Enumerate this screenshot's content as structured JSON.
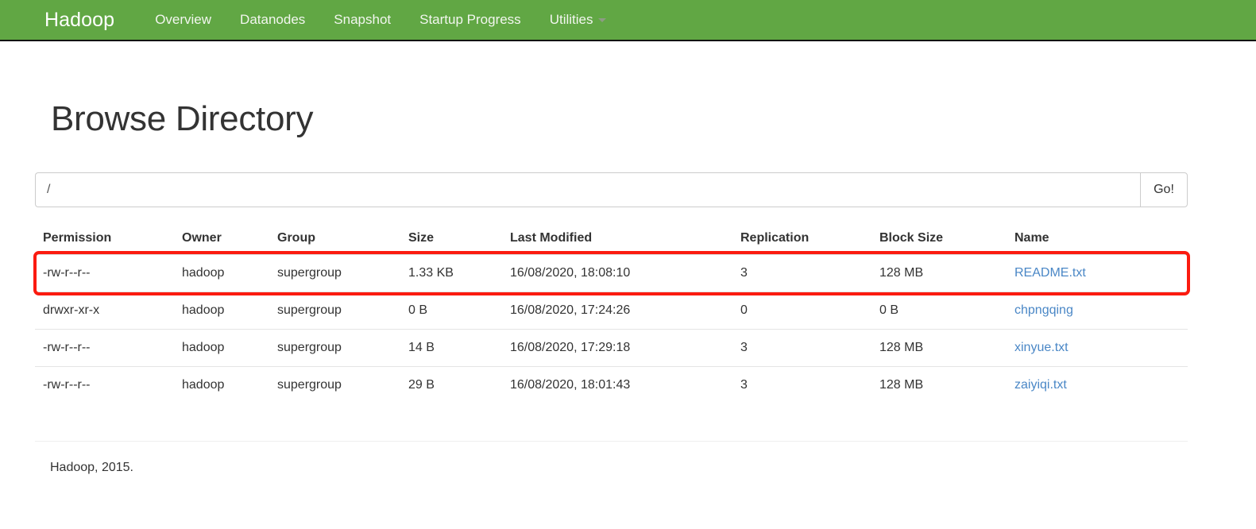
{
  "navbar": {
    "brand": "Hadoop",
    "bg_color": "#61a744",
    "items": [
      {
        "label": "Overview",
        "name": "nav-overview",
        "caret": false
      },
      {
        "label": "Datanodes",
        "name": "nav-datanodes",
        "caret": false
      },
      {
        "label": "Snapshot",
        "name": "nav-snapshot",
        "caret": false
      },
      {
        "label": "Startup Progress",
        "name": "nav-startup-progress",
        "caret": false
      },
      {
        "label": "Utilities",
        "name": "nav-utilities",
        "caret": true
      }
    ]
  },
  "page": {
    "title": "Browse Directory"
  },
  "path_form": {
    "value": "/",
    "placeholder": "",
    "go_label": "Go!"
  },
  "table": {
    "columns": [
      "Permission",
      "Owner",
      "Group",
      "Size",
      "Last Modified",
      "Replication",
      "Block Size",
      "Name"
    ],
    "rows": [
      {
        "permission": "-rw-r--r--",
        "owner": "hadoop",
        "group": "supergroup",
        "size": "1.33 KB",
        "last_modified": "16/08/2020, 18:08:10",
        "replication": "3",
        "block_size": "128 MB",
        "name": "README.txt",
        "highlighted": true
      },
      {
        "permission": "drwxr-xr-x",
        "owner": "hadoop",
        "group": "supergroup",
        "size": "0 B",
        "last_modified": "16/08/2020, 17:24:26",
        "replication": "0",
        "block_size": "0 B",
        "name": "chpngqing",
        "highlighted": false
      },
      {
        "permission": "-rw-r--r--",
        "owner": "hadoop",
        "group": "supergroup",
        "size": "14 B",
        "last_modified": "16/08/2020, 17:29:18",
        "replication": "3",
        "block_size": "128 MB",
        "name": "xinyue.txt",
        "highlighted": false
      },
      {
        "permission": "-rw-r--r--",
        "owner": "hadoop",
        "group": "supergroup",
        "size": "29 B",
        "last_modified": "16/08/2020, 18:01:43",
        "replication": "3",
        "block_size": "128 MB",
        "name": "zaiyiqi.txt",
        "highlighted": false
      }
    ]
  },
  "annotation": {
    "highlight_color": "#fb1b10",
    "highlight_target_row": 0
  },
  "footer": {
    "text": "Hadoop, 2015."
  }
}
